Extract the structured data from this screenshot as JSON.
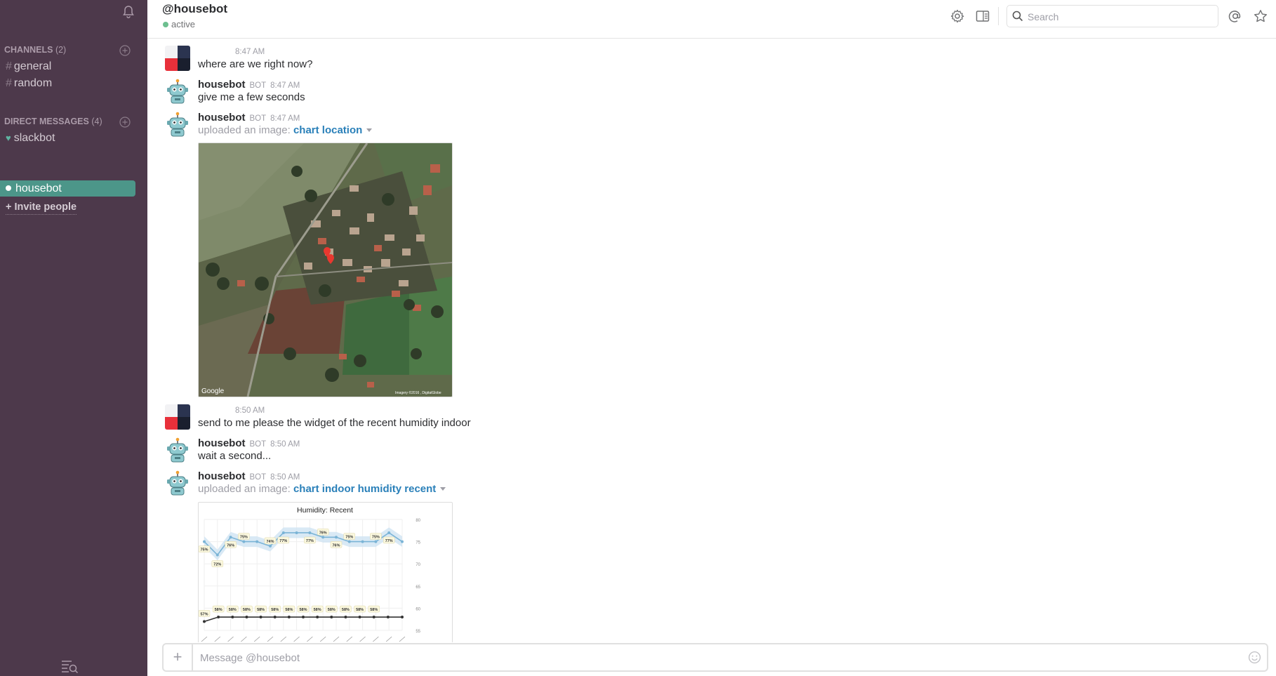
{
  "sidebar": {
    "channels_header": "CHANNELS",
    "channels_count": "(2)",
    "channels": [
      {
        "prefix": "#",
        "label": "general"
      },
      {
        "prefix": "#",
        "label": "random"
      }
    ],
    "dm_header": "DIRECT MESSAGES",
    "dm_count": "(4)",
    "dms": [
      {
        "prefix": "♥",
        "label": "slackbot"
      }
    ],
    "active_dm": "housebot",
    "invite_label": "+ Invite people"
  },
  "header": {
    "title": "@housebot",
    "status": "active",
    "search_placeholder": "Search"
  },
  "messages": [
    {
      "author": "",
      "bot": "",
      "time": "8:47 AM",
      "text": "where are we right now?",
      "avatar": "user"
    },
    {
      "author": "housebot",
      "bot": "BOT",
      "time": "8:47 AM",
      "text": "give me a few seconds",
      "avatar": "robot"
    },
    {
      "author": "housebot",
      "bot": "BOT",
      "time": "8:47 AM",
      "text": "uploaded an image: ",
      "link": "chart location",
      "avatar": "robot"
    },
    {
      "author": "",
      "bot": "",
      "time": "8:50 AM",
      "text": "send to me please the widget of the recent humidity indoor",
      "avatar": "user"
    },
    {
      "author": "housebot",
      "bot": "BOT",
      "time": "8:50 AM",
      "text": "wait a second...",
      "avatar": "robot"
    },
    {
      "author": "housebot",
      "bot": "BOT",
      "time": "8:50 AM",
      "text": "uploaded an image: ",
      "link": "chart indoor humidity recent",
      "avatar": "robot"
    }
  ],
  "map_image": {
    "watermark": "Google",
    "credit": "Imagery ©2016 , DigitalGlobe"
  },
  "chart_data": {
    "type": "line",
    "title": "Humidity: Recent",
    "xlabel": "",
    "ylabel": "",
    "ylim": [
      55,
      80
    ],
    "yticks": [
      55,
      60,
      65,
      70,
      75,
      80
    ],
    "series": [
      {
        "name": "",
        "values": [
          75,
          72,
          76,
          75,
          75,
          74,
          77,
          77,
          77,
          76,
          76,
          75,
          75,
          75,
          77,
          75
        ],
        "labels": [
          "75%",
          "72%",
          "76%",
          "75%",
          "",
          "74%",
          "77%",
          "",
          "77%",
          "76%",
          "76%",
          "75%",
          "",
          "75%",
          "77%",
          ""
        ]
      },
      {
        "name": "",
        "values": [
          57,
          58,
          58,
          58,
          58,
          58,
          58,
          58,
          58,
          58,
          58,
          58,
          58,
          58,
          58
        ],
        "labels": [
          "57%",
          "58%",
          "58%",
          "58%",
          "58%",
          "58%",
          "58%",
          "58%",
          "58%",
          "58%",
          "58%",
          "58%",
          "58%"
        ]
      }
    ]
  },
  "composer": {
    "plus_label": "+",
    "placeholder": "Message @housebot"
  }
}
